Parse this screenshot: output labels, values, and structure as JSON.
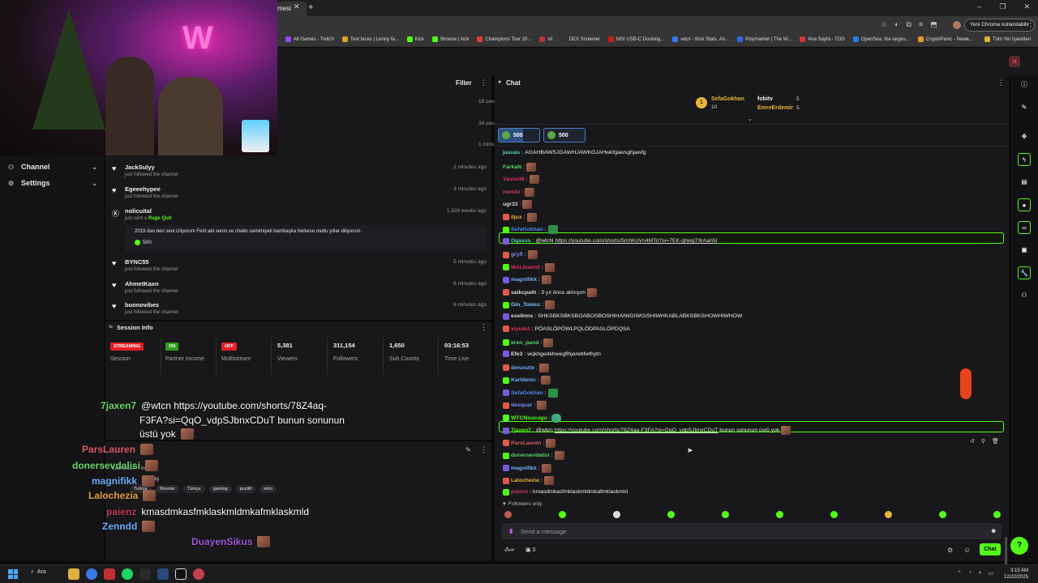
{
  "browser": {
    "tab_title": "mesi",
    "close_glyph": "✕",
    "new_tab_glyph": "+",
    "window_controls": [
      "–",
      "❐",
      "✕"
    ],
    "toolbar_icons": [
      "☆",
      "◐",
      "⧉",
      "≡",
      "⬒"
    ],
    "chrome_update": "Yeni Chrome kullanılabilir",
    "menu_glyph": "⋮",
    "bookmarks": [
      "All Games - Twitch",
      "Text faces | Lenny fa...",
      "Kick",
      "Browse | kick",
      "Champions Tour 20...",
      "vlr",
      "DEX Screener",
      "MSI USB-C Docking...",
      "wtcn - Kick Stats, An...",
      "Polymarket | The W...",
      "Ana Sayfa - TOD",
      "OpenSea, the larges...",
      "CryptoPanic - News..."
    ],
    "bookmarks_more": "»",
    "all_bookmarks": "Tüm Yer İşaretleri"
  },
  "nav": {
    "channel": "Channel",
    "settings": "Settings",
    "chevron": "⌄"
  },
  "activity": {
    "filter": "Filter",
    "dots": "⋮",
    "times_top": [
      "18 seconds ago",
      "34 seconds ago",
      "1 minute ago"
    ],
    "rows": [
      {
        "name": "JackSulyy",
        "sub": "just followed the channel",
        "time": "2 minutes ago"
      },
      {
        "name": "Egeeehypee",
        "sub": "just followed the channel",
        "time": "3 minutes ago"
      }
    ],
    "rage": {
      "name": "nolicuital",
      "sub_prefix": "just sent a",
      "sub_item": "Rage Quit",
      "time": "1,928 weeks ago",
      "message": "2019 dan beri seni izliyorum Ferit abi senin ve chatin samimiyeti bambaşka herkese mutlu yıllar diliyorum",
      "amount": "500"
    },
    "rows2": [
      {
        "name": "BYNC55",
        "sub": "just followed the channel",
        "time": "5 minutes ago"
      },
      {
        "name": "AhmetKaxn",
        "sub": "just followed the channel",
        "time": "6 minutes ago"
      },
      {
        "name": "buonovibes",
        "sub": "just followed the channel",
        "time": "6 minutes ago"
      }
    ]
  },
  "session": {
    "title": "Session Info",
    "arrows": "⇆",
    "dots": "⋮",
    "metrics": [
      {
        "badge": "STREAMING",
        "label": "Session",
        "color": "#e3202a"
      },
      {
        "badge": "ON",
        "label": "Partner Income",
        "color": "#2e9e1a"
      },
      {
        "badge": "OFF",
        "label": "Multistream",
        "color": "#e3202a"
      },
      {
        "value": "5,381",
        "label": "Viewers"
      },
      {
        "value": "311,154",
        "label": "Followers"
      },
      {
        "value": "1,650",
        "label": "Sub Counts"
      },
      {
        "value": "03:16:53",
        "label": "Time Live"
      }
    ]
  },
  "about": {
    "line1": "Last 2024",
    "line2": "indirim",
    "line3": "etting",
    "tags": [
      "Turkçe",
      "Shooter",
      "Türkçe",
      "gaming",
      "pozitif",
      "wtcn"
    ],
    "edit_glyph": "✎",
    "dots": "⋮"
  },
  "chat": {
    "title": "Chat",
    "dots": "⋮",
    "leaderboard": {
      "top_name": "SefaGokhan",
      "top_num": "10",
      "crown": "1",
      "second": "fobitv",
      "second_num": "5",
      "third": "EmreErdemir",
      "third_num": "5"
    },
    "collapse_glyph": "⌄",
    "kicks": [
      "500",
      "500"
    ],
    "messages": [
      {
        "user": "jasuas",
        "color": "#53d4c0",
        "text": "AGAHBAWSJGAWHJAWKGJAHwkfgawsghjawfg"
      },
      {
        "user": "FarkaN",
        "color": "#5ad36a",
        "emote": true
      },
      {
        "user": "Yavuz46",
        "color": "#e0305a",
        "emote": true
      },
      {
        "user": "nom3z",
        "color": "#d03a60",
        "emote": true
      },
      {
        "user": "ugr33",
        "color": "#dcdcdc",
        "emote": true
      },
      {
        "user": "iljux",
        "color": "#e8b43a",
        "emote": true
      },
      {
        "user": "SefaGokhan",
        "color": "#4a8ae8",
        "emote_green": true
      },
      {
        "user": "Ogasss",
        "color": "#53d4c0",
        "text": "@wtcN",
        "link": "https://youtube.com/shorts/5mhKoVn4MTo?si=7EK-ghwgT9rAah5l",
        "highlight": true
      },
      {
        "user": "gryfl",
        "color": "#7a8aff",
        "emote": true
      },
      {
        "user": "MALiksen0",
        "color": "#e0305a",
        "emote": true
      },
      {
        "user": "magnifikk",
        "color": "#6ab0ff",
        "emote": true
      },
      {
        "user": "saikcpath",
        "color": "#dcdcdc",
        "text": "3 yıl önce almışım",
        "emote": true
      },
      {
        "user": "Gin_Tonicc",
        "color": "#7ad0ff",
        "emote": true
      },
      {
        "user": "esellnns",
        "color": "#dcdcdc",
        "text": "SHKSBKSBKSBOABOSBOSHIHAIWGIWGISHIWHKABLABKSBKSHOWHIWHOW"
      },
      {
        "user": "xiyrek4",
        "color": "#e0305a",
        "text": "PÖASLÖPÖWLPQLÖDPASLÖPDQSA"
      },
      {
        "user": "eren_pand",
        "color": "#5ad36a",
        "emote": true
      },
      {
        "user": "Efe3",
        "color": "#dcdcdc",
        "text": "wqkhgedkhwegflhjarebfwthytn"
      },
      {
        "user": "denzozte",
        "color": "#6ab0ff",
        "emote": true
      },
      {
        "user": "Karldenic",
        "color": "#6ab0ff",
        "emote": true
      },
      {
        "user": "SefaGokhan",
        "color": "#4a8ae8",
        "emote_green": true
      },
      {
        "user": "desquar",
        "color": "#7a8aff",
        "emote": true
      },
      {
        "user": "WTCNsucugu",
        "color": "#53fc18",
        "emote_pepe": true
      },
      {
        "user": "7jaxen7",
        "color": "#53fc18",
        "text": "@wtcn",
        "link": "https://youtube.com/shorts/78Z4aq-F3FA?si=QqO_vdpSJbnxCDuT",
        "after": "bunun sonunun üstü yok",
        "emote": true,
        "highlight": true
      },
      {
        "user": "ParsLauren",
        "color": "#e05a6a",
        "emote": true
      },
      {
        "user": "donersevdalisi",
        "color": "#5ad36a",
        "emote": true
      },
      {
        "user": "magnifikk",
        "color": "#6ab0ff",
        "emote": true
      },
      {
        "user": "Lalochezia",
        "color": "#e8b43a",
        "emote": true
      },
      {
        "user": "paienz",
        "color": "#c43a5a",
        "text": "kmasdmkasfmklaskmldmkafmklaskmld"
      }
    ],
    "followers_only": "Followers only",
    "input_placeholder": "Send a message",
    "footer_left": [
      "∞",
      "0"
    ],
    "send_label": "Chat"
  },
  "overlay_chat": [
    {
      "user": "7jaxen7",
      "color": "#6ad86a",
      "text": "@wtcn https://youtube.com/shorts/78Z4aq-"
    },
    {
      "user": "",
      "color": "#fff",
      "text": "F3FA?si=QqO_vdpSJbnxCDuT bunun sonunun"
    },
    {
      "user": "",
      "color": "#fff",
      "text": "üstü yok"
    },
    {
      "user": "ParsLauren",
      "color": "#e05a6a",
      "text": ""
    },
    {
      "user": "donersevdalisi",
      "color": "#6ad86a",
      "text": ""
    },
    {
      "user": "magnifikk",
      "color": "#6ab0ff",
      "text": ""
    },
    {
      "user": "Lalochezia",
      "color": "#e8a43a",
      "text": ""
    },
    {
      "user": "paienz",
      "color": "#c43a5a",
      "text": "kmasdmkasfmklaskmldmkafmklaskmld"
    },
    {
      "user": "Zenndd",
      "color": "#6ab0ff",
      "text": ""
    },
    {
      "user": "DuayenSikus",
      "color": "#a05ad8",
      "text": ""
    }
  ],
  "taskbar": {
    "search": "Ara",
    "time": "3:15 AM",
    "date": "12/22/2025"
  }
}
